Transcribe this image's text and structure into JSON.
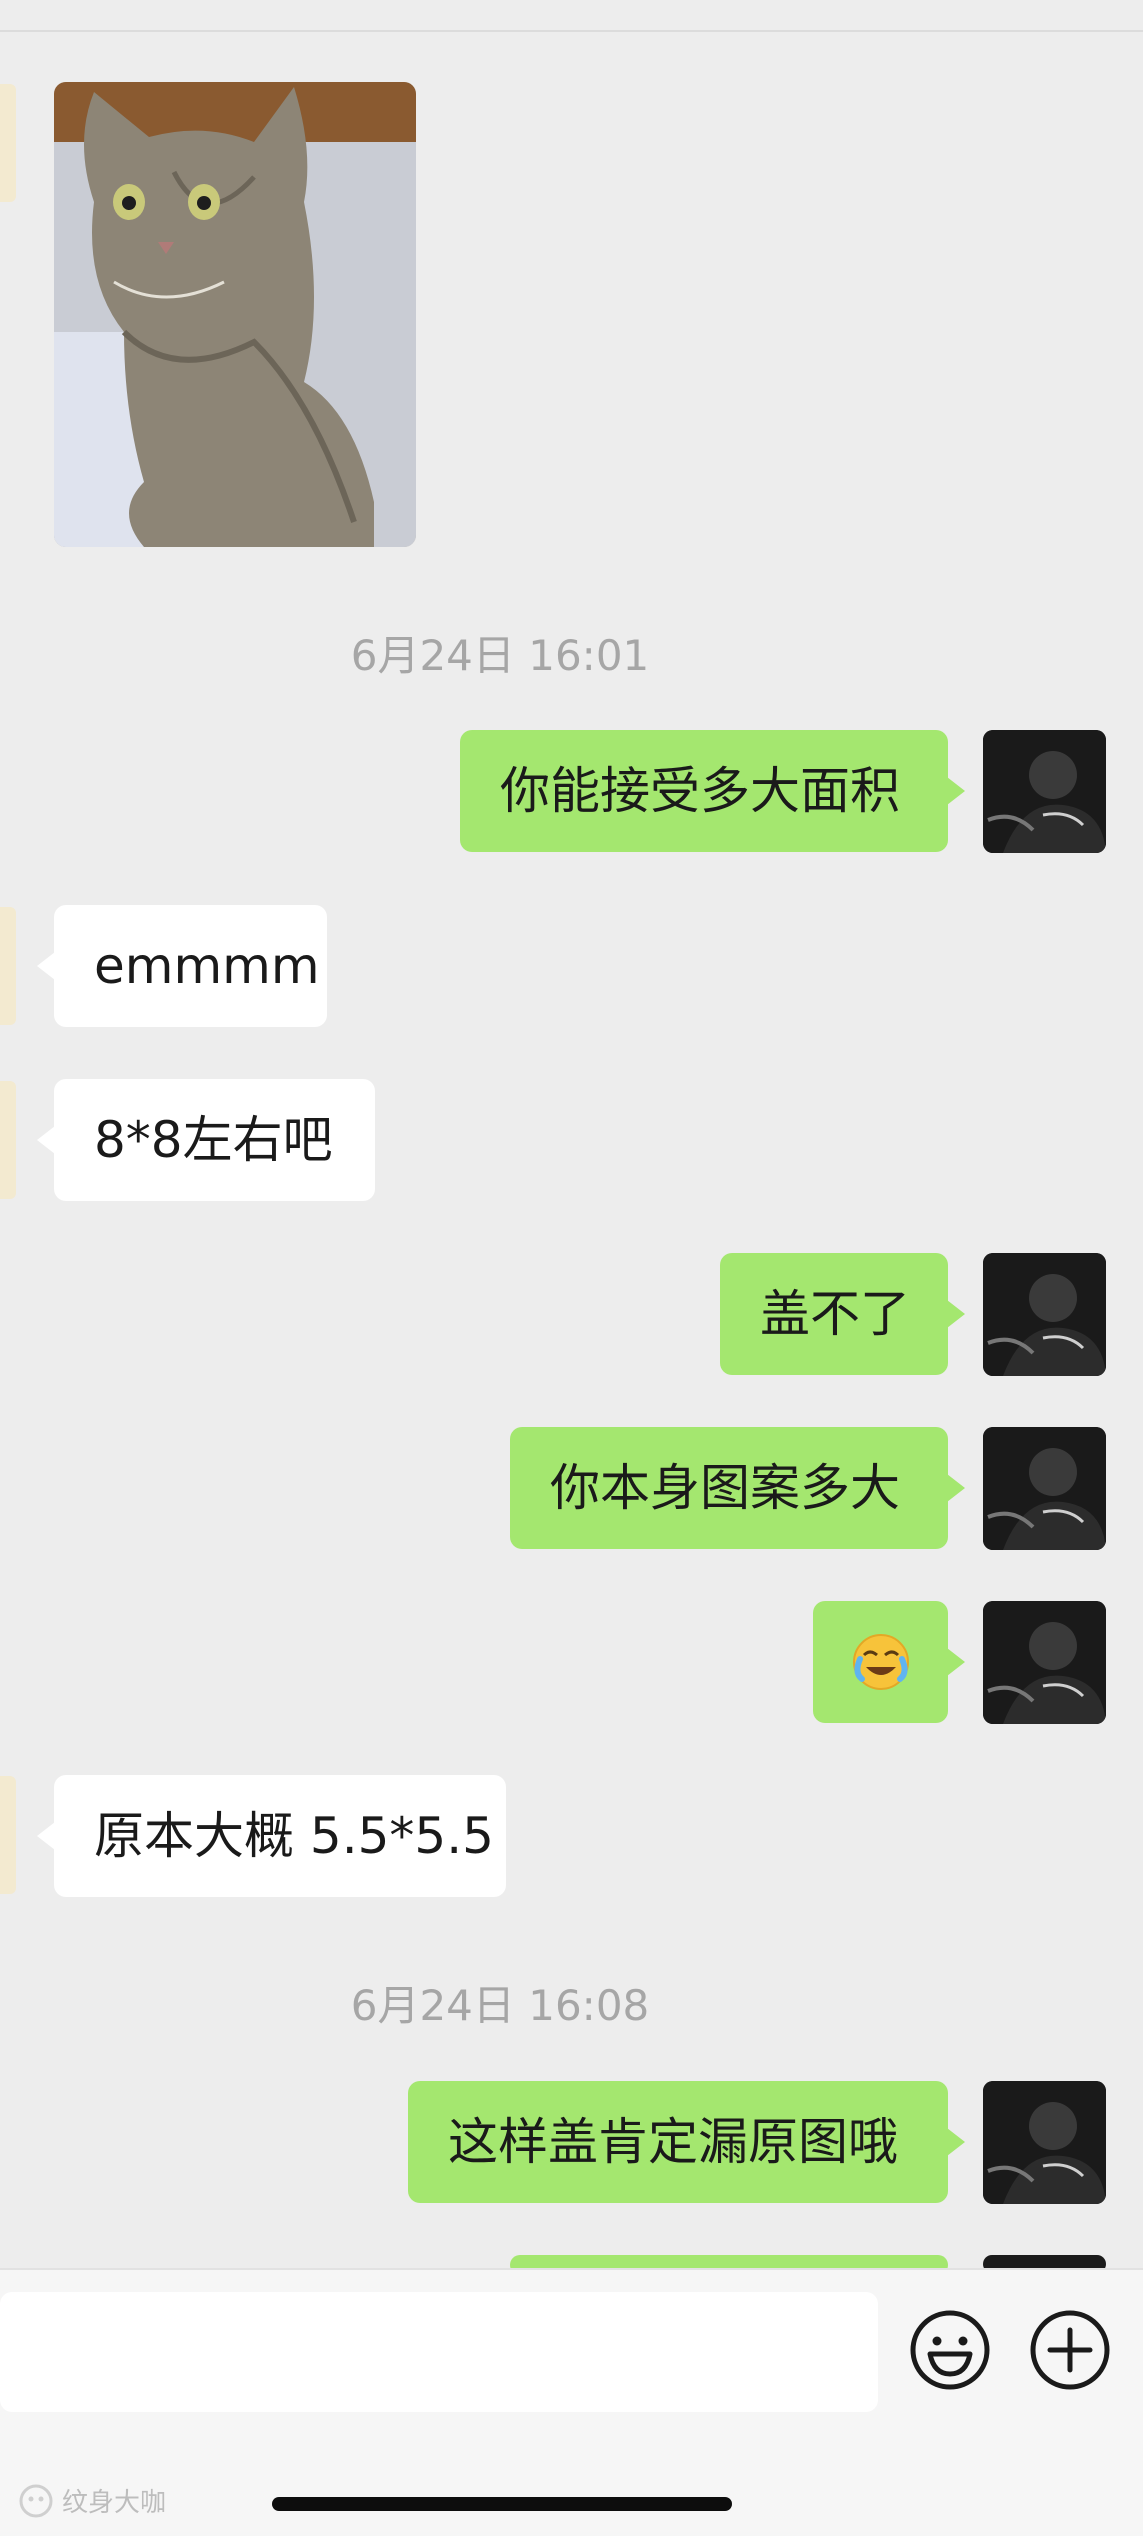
{
  "messages": [
    {
      "type": "image",
      "side": "in",
      "alt": "cat photo"
    },
    {
      "type": "timestamp",
      "text": "6月24日 16:01"
    },
    {
      "type": "text",
      "side": "out",
      "text": "你能接受多大面积"
    },
    {
      "type": "text",
      "side": "in",
      "text": "emmmm"
    },
    {
      "type": "text",
      "side": "in",
      "text": "8*8左右吧"
    },
    {
      "type": "text",
      "side": "out",
      "text": "盖不了"
    },
    {
      "type": "text",
      "side": "out",
      "text": "你本身图案多大"
    },
    {
      "type": "emoji",
      "side": "out",
      "emoji": "😭"
    },
    {
      "type": "text",
      "side": "in",
      "text": "原本大概 5.5*5.5"
    },
    {
      "type": "timestamp",
      "text": "6月24日 16:08"
    },
    {
      "type": "text",
      "side": "out",
      "text": "这样盖肯定漏原图哦"
    }
  ],
  "input": {
    "placeholder": ""
  },
  "icons": {
    "emoji_button": "smiley-icon",
    "more_button": "plus-circle-icon"
  },
  "watermark": {
    "text": "纹身大咖"
  },
  "colors": {
    "background": "#ededed",
    "outgoing_bubble": "#a4e76f",
    "incoming_bubble": "#ffffff"
  }
}
